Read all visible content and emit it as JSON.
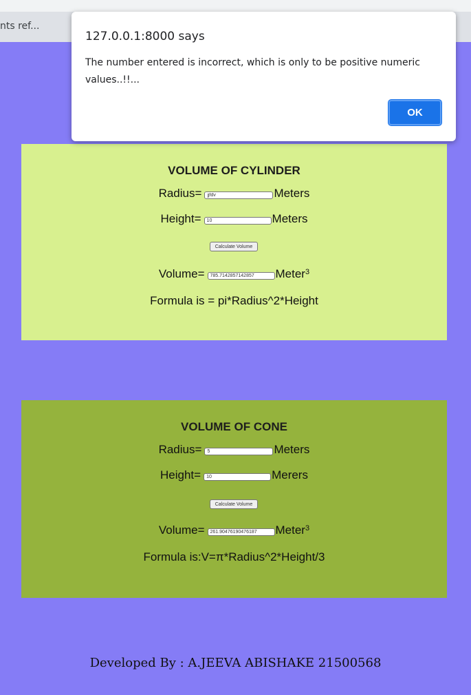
{
  "browser": {
    "bookmark_label": "nts ref..."
  },
  "alert": {
    "title": "127.0.0.1:8000 says",
    "message": "The number entered is incorrect, which is only to be positive numeric values..!!...",
    "ok_label": "OK"
  },
  "cylinder": {
    "heading": "VOLUME OF CYLINDER",
    "radius_label": "Radius=",
    "radius_value": "jjfdv",
    "radius_unit": "Meters",
    "height_label": "Height=",
    "height_value": "10",
    "height_unit": "Meters",
    "button_label": "Calculate Volume",
    "volume_label": "Volume=",
    "volume_value": "785.7142857142857",
    "volume_unit": "Meter",
    "volume_exponent": "3",
    "formula": "Formula is = pi*Radius^2*Height"
  },
  "cone": {
    "heading": "VOLUME OF CONE",
    "radius_label": "Radius=",
    "radius_value": "5",
    "radius_unit": "Meters",
    "height_label": "Height=",
    "height_value": "10",
    "height_unit": "Merers",
    "button_label": "Calculate Volume",
    "volume_label": "Volume=",
    "volume_value": "261.90476190476187",
    "volume_unit": "Meter",
    "volume_exponent": "3",
    "formula": "Formula is:V=π*Radius^2*Height/3"
  },
  "footer": {
    "text": "Developed By : A.JEEVA ABISHAKE 21500568"
  },
  "colors": {
    "page_background": "#857cf6",
    "cylinder_panel": "#d8f08f",
    "cone_panel": "#95b33d",
    "ok_button": "#1a73e8"
  }
}
